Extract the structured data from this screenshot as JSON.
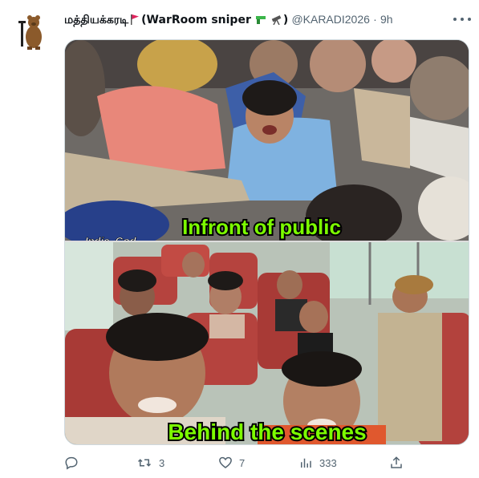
{
  "tweet": {
    "display_name": "மத்தியக்கரடி",
    "display_name_suffix": "(WarRoom sniper",
    "display_name_close": ")",
    "handle": "@KARADI2026",
    "separator": "·",
    "time": "9h"
  },
  "media": {
    "watermark": "Indic_God",
    "top_caption": "Infront of public",
    "bottom_caption": "Behind the scenes",
    "caption_color": "#7CFC00"
  },
  "actions": {
    "reply_count": "",
    "retweet_count": "3",
    "like_count": "7",
    "views_count": "333"
  },
  "icons": {
    "more": "more-dots-icon",
    "reply": "reply-icon",
    "retweet": "retweet-icon",
    "like": "heart-icon",
    "views": "views-icon",
    "share": "share-icon"
  },
  "colors": {
    "muted": "#536471",
    "text": "#0f1419",
    "flag_red": "#e0245e",
    "border": "#cfd9de"
  }
}
